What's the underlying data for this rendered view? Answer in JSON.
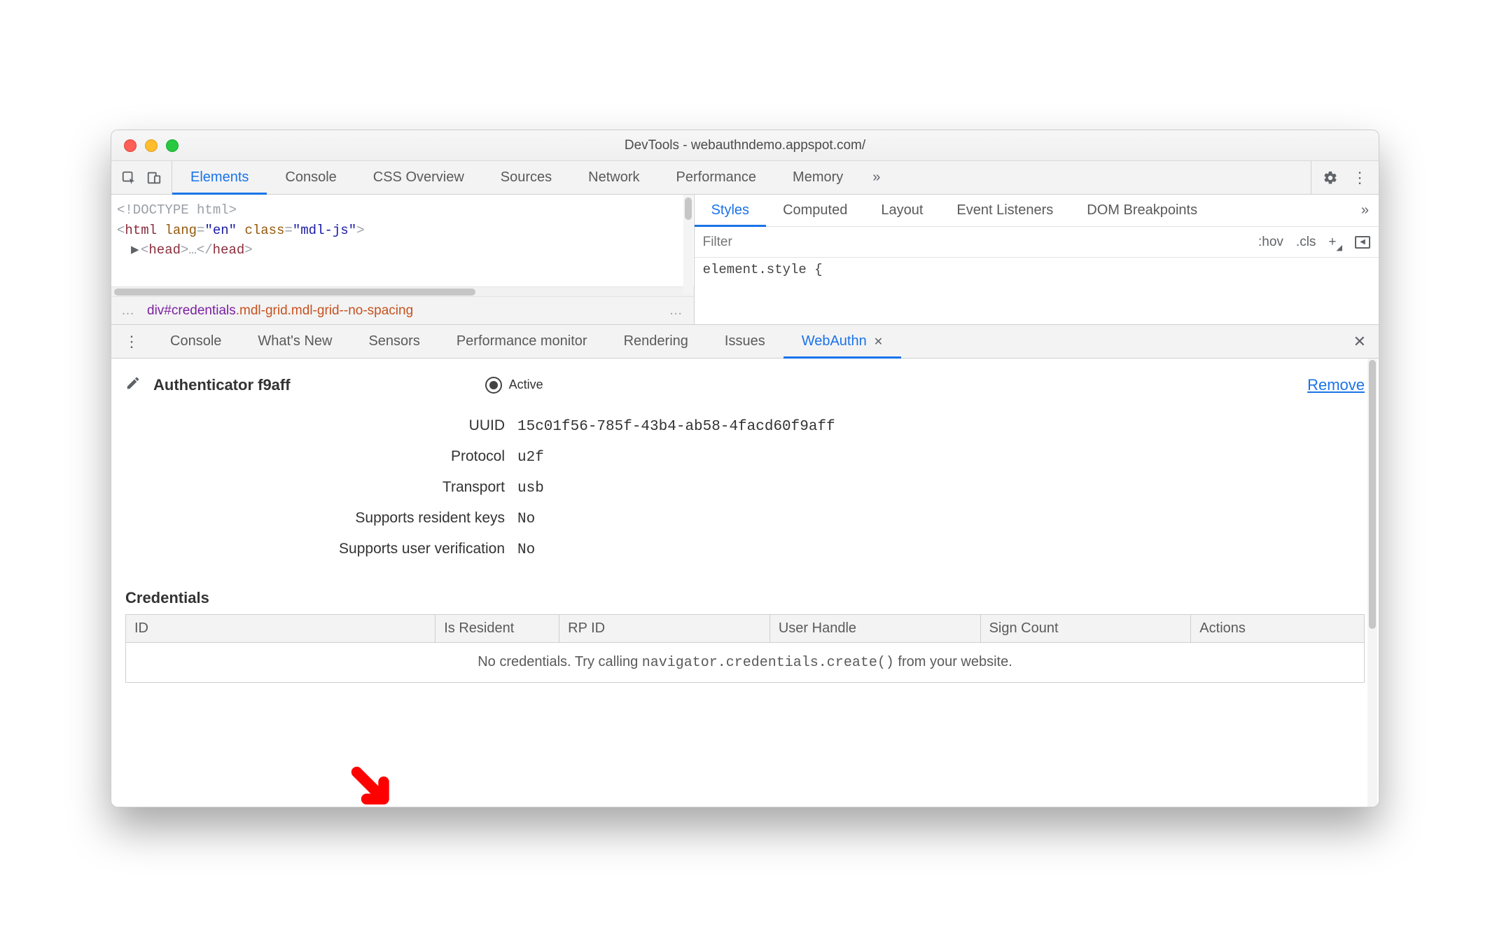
{
  "window": {
    "title": "DevTools - webauthndemo.appspot.com/"
  },
  "main_tabs": {
    "items": [
      "Elements",
      "Console",
      "CSS Overview",
      "Sources",
      "Network",
      "Performance",
      "Memory"
    ],
    "active_index": 0,
    "overflow_glyph": "»"
  },
  "dom_source": {
    "line1": "<!DOCTYPE html>",
    "line2_open": "<",
    "line2_tag": "html",
    "line2_attr1_name": "lang",
    "line2_attr1_val": "\"en\"",
    "line2_attr2_name": "class",
    "line2_attr2_val": "\"mdl-js\"",
    "line2_close": ">",
    "line3_tri": "▶",
    "line3_open": "<",
    "line3_tag": "head",
    "line3_close": ">",
    "line3_ellipsis": "…",
    "line3_endopen": "</",
    "line3_endtag": "head",
    "line3_endclose": ">"
  },
  "crumbs": {
    "lead": "…",
    "tag": "div",
    "id": "#credentials",
    "cls": ".mdl-grid.mdl-grid--no-spacing",
    "trail": "…"
  },
  "styles_tabs": {
    "items": [
      "Styles",
      "Computed",
      "Layout",
      "Event Listeners",
      "DOM Breakpoints"
    ],
    "active_index": 0,
    "overflow_glyph": "»"
  },
  "filter": {
    "placeholder": "Filter",
    "hov": ":hov",
    "cls": ".cls",
    "plus": "+"
  },
  "element_style_text": "element.style {",
  "drawer_tabs": {
    "items": [
      "Console",
      "What's New",
      "Sensors",
      "Performance monitor",
      "Rendering",
      "Issues",
      "WebAuthn"
    ],
    "active_index": 6
  },
  "authenticator": {
    "title": "Authenticator f9aff",
    "active_label": "Active",
    "remove_label": "Remove",
    "rows": [
      {
        "key": "UUID",
        "val": "15c01f56-785f-43b4-ab58-4facd60f9aff",
        "mono": true
      },
      {
        "key": "Protocol",
        "val": "u2f",
        "mono": true
      },
      {
        "key": "Transport",
        "val": "usb",
        "mono": true
      },
      {
        "key": "Supports resident keys",
        "val": "No",
        "mono": true
      },
      {
        "key": "Supports user verification",
        "val": "No",
        "mono": true
      }
    ]
  },
  "credentials": {
    "section_title": "Credentials",
    "headers": [
      "ID",
      "Is Resident",
      "RP ID",
      "User Handle",
      "Sign Count",
      "Actions"
    ],
    "empty_pre": "No credentials. Try calling ",
    "empty_code": "navigator.credentials.create()",
    "empty_post": " from your website."
  }
}
